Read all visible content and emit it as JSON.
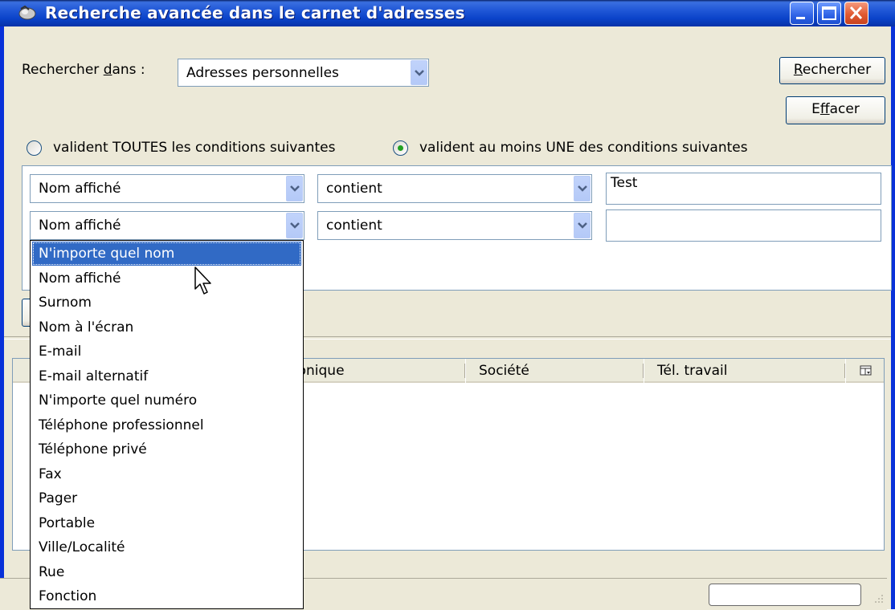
{
  "window": {
    "title": "Recherche avancée dans le carnet d'adresses"
  },
  "search_in": {
    "label_prefix": "Rechercher ",
    "label_underlined": "d",
    "label_suffix": "ans :",
    "selected": "Adresses personnelles"
  },
  "buttons": {
    "search": {
      "underlined": "R",
      "rest": "echercher"
    },
    "clear": {
      "pre": "E",
      "underlined": "f",
      "rest": "facer"
    }
  },
  "match": {
    "all_label": "valident TOUTES les conditions suivantes",
    "any_label": "valident au moins UNE des conditions suivantes",
    "selected": "any"
  },
  "conditions": [
    {
      "field": "Nom affiché",
      "operator": "contient",
      "value": "Test"
    },
    {
      "field": "Nom affiché",
      "operator": "contient",
      "value": ""
    }
  ],
  "results": {
    "columns": [
      "ronique",
      "Société",
      "Tél. travail"
    ]
  },
  "dropdown": {
    "selected_index": 0,
    "items": [
      "N'importe quel nom",
      "Nom affiché",
      "Surnom",
      "Nom à l'écran",
      "E-mail",
      "E-mail alternatif",
      "N'importe quel numéro",
      "Téléphone professionnel",
      "Téléphone privé",
      "Fax",
      "Pager",
      "Portable",
      "Ville/Localité",
      "Rue",
      "Fonction"
    ]
  },
  "icons": {
    "app": "address-book-icon",
    "column_picker": "column-picker-icon",
    "cursor": "mouse-pointer-icon"
  }
}
